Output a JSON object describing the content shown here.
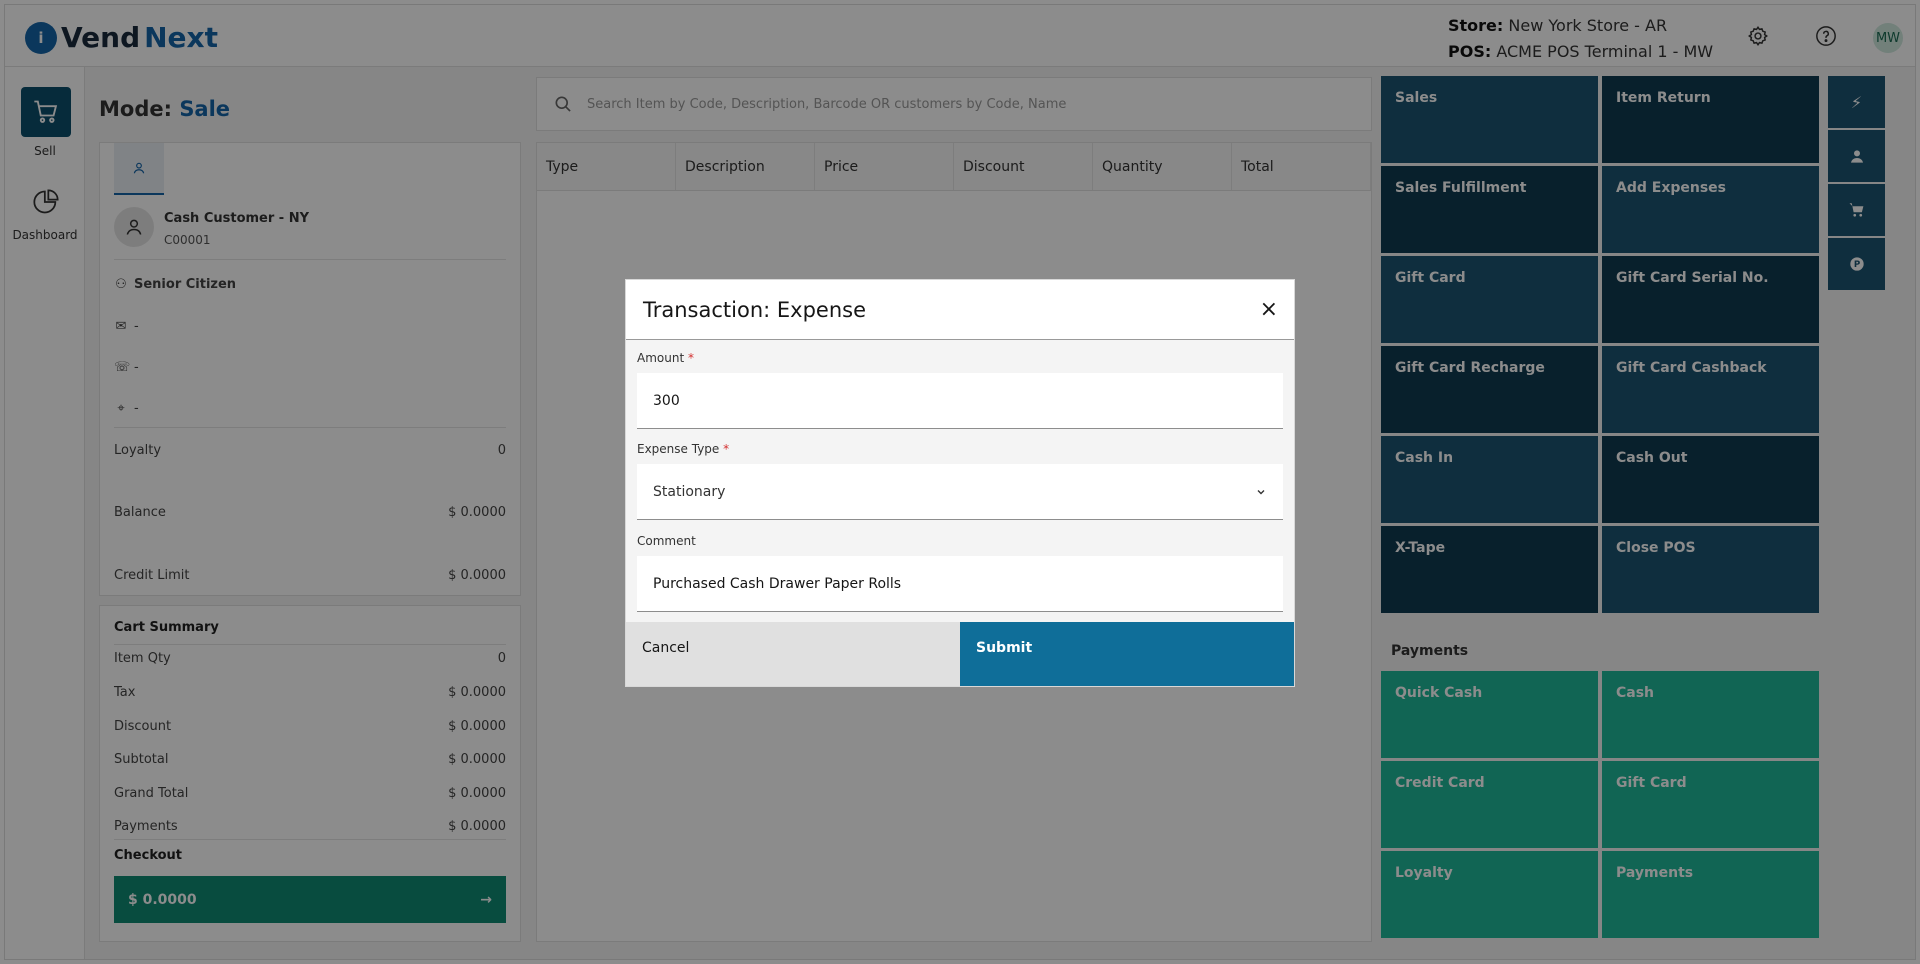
{
  "app": {
    "logo_i": "i",
    "logo_vend": "Vend",
    "logo_next": "Next"
  },
  "header": {
    "store_label": "Store:",
    "store_value": "New York Store - AR",
    "pos_label": "POS:",
    "pos_value": "ACME POS Terminal 1 - MW",
    "user_initials": "MW"
  },
  "rail": {
    "sell_label": "Sell",
    "dashboard_label": "Dashboard"
  },
  "mode": {
    "label": "Mode:",
    "value": "Sale"
  },
  "customer": {
    "name": "Cash Customer - NY",
    "code": "C00001",
    "group": "Senior Citizen",
    "email": "-",
    "phone": "-",
    "address": "-",
    "loyalty_label": "Loyalty",
    "loyalty_value": "0",
    "balance_label": "Balance",
    "balance_value": "$ 0.0000",
    "credit_label": "Credit Limit",
    "credit_value": "$ 0.0000"
  },
  "cart": {
    "title": "Cart Summary",
    "rows": [
      {
        "label": "Item Qty",
        "value": "0"
      },
      {
        "label": "Tax",
        "value": "$ 0.0000"
      },
      {
        "label": "Discount",
        "value": "$ 0.0000"
      },
      {
        "label": "Subtotal",
        "value": "$ 0.0000"
      },
      {
        "label": "Grand Total",
        "value": "$ 0.0000"
      },
      {
        "label": "Payments",
        "value": "$ 0.0000"
      }
    ],
    "checkout_label": "Checkout",
    "checkout_amount": "$ 0.0000"
  },
  "search": {
    "placeholder": "Search Item by Code, Description, Barcode OR customers by Code, Name"
  },
  "table": {
    "columns": [
      "Type",
      "Description",
      "Price",
      "Discount",
      "Quantity",
      "Total"
    ]
  },
  "tiles": {
    "sales": "Sales",
    "item_return": "Item Return",
    "sales_fulfillment": "Sales Fulfillment",
    "add_expenses": "Add Expenses",
    "gift_card": "Gift Card",
    "gift_card_serial": "Gift Card Serial No.",
    "gift_card_recharge": "Gift Card Recharge",
    "gift_card_cashback": "Gift Card Cashback",
    "cash_in": "Cash In",
    "cash_out": "Cash Out",
    "x_tape": "X-Tape",
    "close_pos": "Close POS"
  },
  "payments": {
    "title": "Payments",
    "quick_cash": "Quick Cash",
    "cash": "Cash",
    "credit_card": "Credit Card",
    "gift_card": "Gift Card",
    "loyalty": "Loyalty",
    "payments": "Payments"
  },
  "modal": {
    "title": "Transaction: Expense",
    "close": "×",
    "amount_label": "Amount",
    "amount_value": "300",
    "expense_type_label": "Expense Type",
    "expense_type_value": "Stationary",
    "comment_label": "Comment",
    "comment_value": "Purchased Cash Drawer Paper Rolls",
    "required_mark": "*",
    "cancel": "Cancel",
    "submit": "Submit"
  }
}
